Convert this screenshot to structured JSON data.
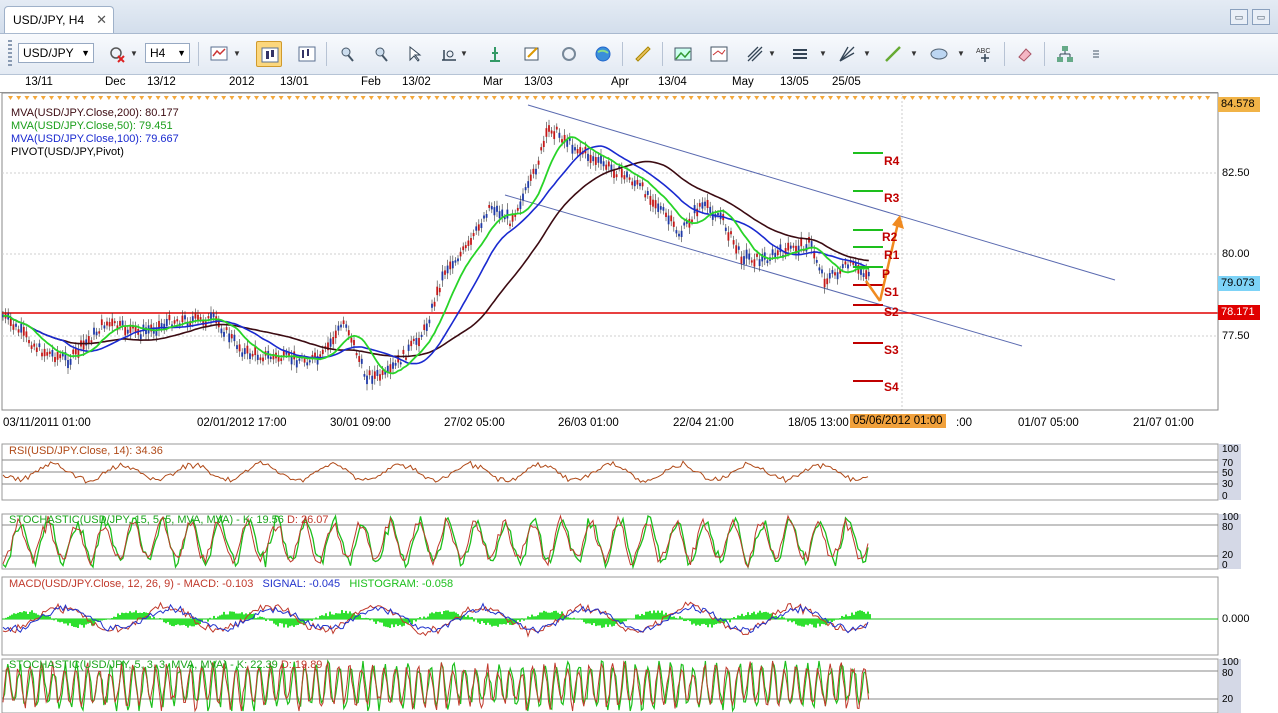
{
  "tab": {
    "title": "USD/JPY, H4",
    "close": "✕"
  },
  "window_controls": [
    "▭",
    "▭"
  ],
  "toolbar": {
    "symbol": "USD/JPY",
    "timeframe": "H4",
    "icons": [
      "chart-type-icon",
      "delete-indicator-icon",
      "bar-style-icon",
      "candle-style-icon",
      "zoom-in-icon",
      "zoom-out-icon",
      "cursor-icon",
      "crosshair-icon",
      "volume-icon",
      "properties-icon",
      "refresh-icon",
      "globe-icon",
      "ruler-icon",
      "image-icon",
      "template-icon",
      "pitchfork-icon",
      "lines-icon",
      "fan-icon",
      "trendline-icon",
      "ellipse-icon",
      "text-icon",
      "eraser-icon",
      "hierarchy-icon"
    ]
  },
  "top_axis": [
    "13/11",
    "Dec",
    "13/12",
    "2012",
    "13/01",
    "Feb",
    "13/02",
    "Mar",
    "13/03",
    "Apr",
    "13/04",
    "May",
    "13/05",
    "25/05"
  ],
  "main": {
    "legend": [
      "MVA(USD/JPY.Close,200): 80.177",
      "MVA(USD/JPY.Close,50): 79.451",
      "MVA(USD/JPY.Close,100): 79.667",
      "PIVOT(USD/JPY,Pivot)"
    ],
    "price_labels": [
      "82.50",
      "80.00",
      "77.50"
    ],
    "tags": {
      "high": "84.578",
      "last": "79.073",
      "line": "78.171"
    },
    "pivots": [
      "R4",
      "R3",
      "R2",
      "R1",
      "P",
      "S1",
      "S2",
      "S3",
      "S4"
    ],
    "x_labels": [
      "03/11/2011 01:00",
      "02/01/2012 17:00",
      "30/01 09:00",
      "27/02 05:00",
      "26/03 01:00",
      "22/04 21:00",
      "18/05 13:00",
      "05/06/2012 01:00",
      ":00",
      "01/07 05:00",
      "21/07 01:00"
    ]
  },
  "rsi": {
    "title": "RSI(USD/JPY.Close, 14): 34.36",
    "scale": [
      "100",
      "70",
      "50",
      "30",
      "0"
    ]
  },
  "stoch1": {
    "title": "STOCHASTIC(USD/JPY, 15, 5, 5, MVA, MVA) - ",
    "k": "K: 19.56",
    "d": "D: 26.07",
    "scale": [
      "100",
      "80",
      "20",
      "0"
    ]
  },
  "macd": {
    "title": "MACD(USD/JPY.Close, 12, 26, 9) - ",
    "macd": "MACD: -0.103",
    "signal": "SIGNAL: -0.045",
    "hist": "HISTOGRAM: -0.058",
    "scale": [
      "0.000"
    ]
  },
  "stoch2": {
    "title": "STOCHASTIC(USD/JPY, 5, 3, 3, MVA, MVA) - ",
    "k": "K: 22.39",
    "d": "D: 19.89",
    "scale": [
      "100",
      "80",
      "20"
    ]
  }
}
